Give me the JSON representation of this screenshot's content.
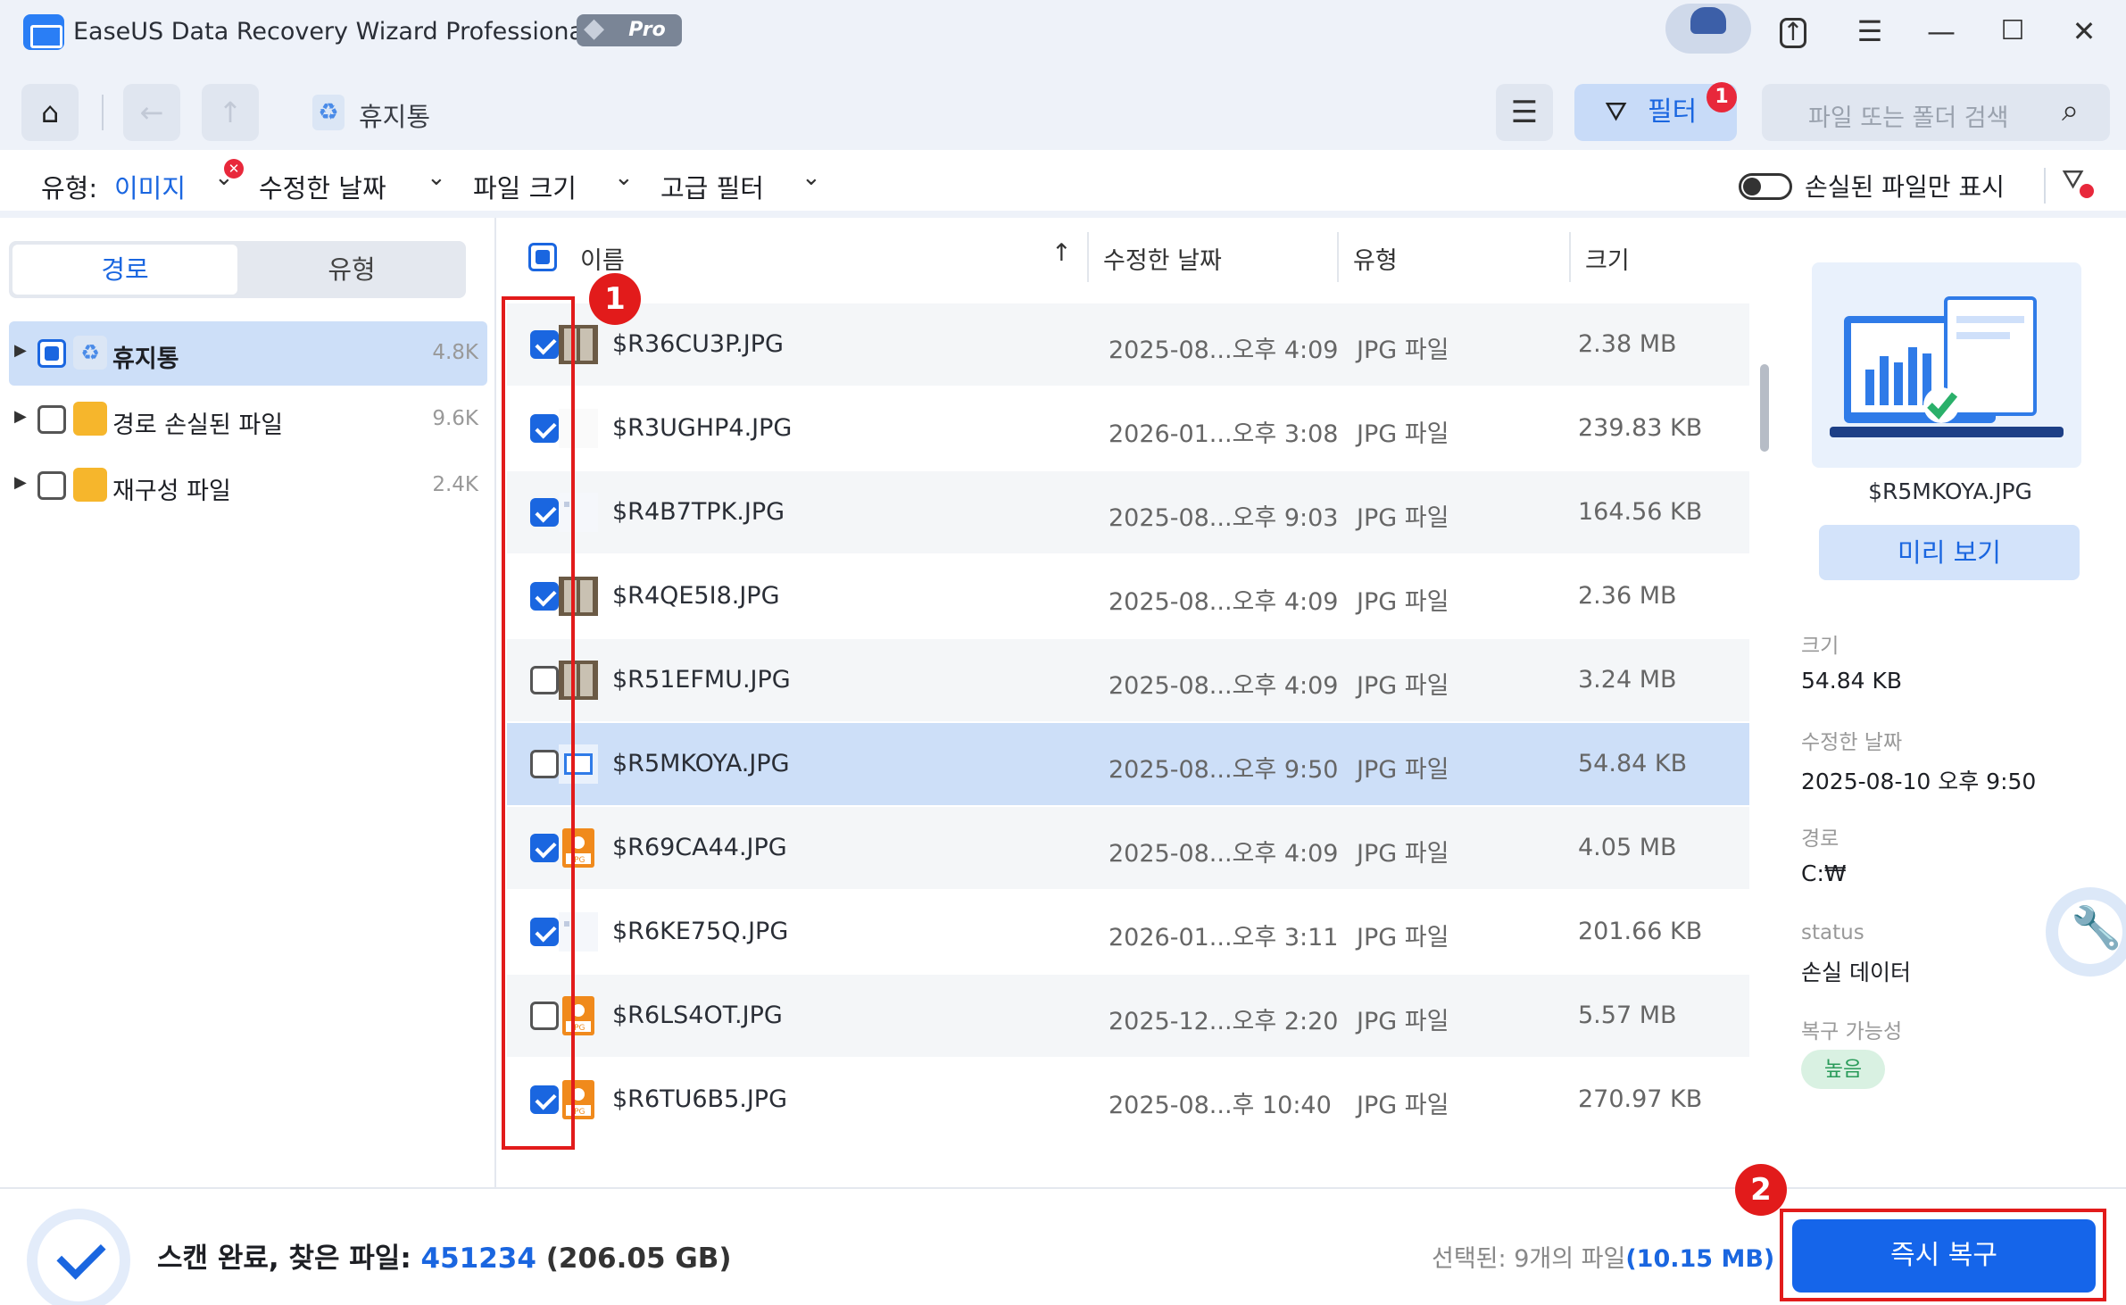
{
  "app": {
    "title": "EaseUS Data Recovery Wizard Professional",
    "badge": "Pro"
  },
  "nav": {
    "breadcrumb": "휴지통",
    "filter_label": "필터",
    "filter_count": "1",
    "search_placeholder": "파일 또는 폴더 검색"
  },
  "filters": {
    "type_label": "유형:",
    "type_value": "이미지",
    "modified_label": "수정한 날짜",
    "size_label": "파일 크기",
    "advanced_label": "고급 필터",
    "lost_only_label": "손실된 파일만 표시",
    "lost_only_on": false
  },
  "sidebar": {
    "tabs": [
      "경로",
      "유형"
    ],
    "active_tab": "경로",
    "items": [
      {
        "label": "휴지통",
        "count": "4.8K",
        "state": "partial",
        "selected": true
      },
      {
        "label": "경로 손실된 파일",
        "count": "9.6K",
        "state": "unchecked",
        "selected": false
      },
      {
        "label": "재구성 파일",
        "count": "2.4K",
        "state": "unchecked",
        "selected": false
      }
    ]
  },
  "table": {
    "columns": [
      "이름",
      "수정한 날짜",
      "유형",
      "크기"
    ],
    "sort_indicator": "↑",
    "rows": [
      {
        "name": "$R36CU3P.JPG",
        "date": "2025-08...오후 4:09",
        "type": "JPG 파일",
        "size": "2.38 MB",
        "checked": true,
        "selected": false,
        "thumb": "doors"
      },
      {
        "name": "$R3UGHP4.JPG",
        "date": "2026-01...오후 3:08",
        "type": "JPG 파일",
        "size": "239.83 KB",
        "checked": true,
        "selected": false,
        "thumb": "blank"
      },
      {
        "name": "$R4B7TPK.JPG",
        "date": "2025-08...오후 9:03",
        "type": "JPG 파일",
        "size": "164.56 KB",
        "checked": true,
        "selected": false,
        "thumb": "light"
      },
      {
        "name": "$R4QE5I8.JPG",
        "date": "2025-08...오후 4:09",
        "type": "JPG 파일",
        "size": "2.36 MB",
        "checked": true,
        "selected": false,
        "thumb": "doors"
      },
      {
        "name": "$R51EFMU.JPG",
        "date": "2025-08...오후 4:09",
        "type": "JPG 파일",
        "size": "3.24 MB",
        "checked": false,
        "selected": false,
        "thumb": "doors"
      },
      {
        "name": "$R5MKOYA.JPG",
        "date": "2025-08...오후 9:50",
        "type": "JPG 파일",
        "size": "54.84 KB",
        "checked": false,
        "selected": true,
        "thumb": "chart"
      },
      {
        "name": "$R69CA44.JPG",
        "date": "2025-08...오후 4:09",
        "type": "JPG 파일",
        "size": "4.05 MB",
        "checked": true,
        "selected": false,
        "thumb": "jpg"
      },
      {
        "name": "$R6KE75Q.JPG",
        "date": "2026-01...오후 3:11",
        "type": "JPG 파일",
        "size": "201.66 KB",
        "checked": true,
        "selected": false,
        "thumb": "light"
      },
      {
        "name": "$R6LS4OT.JPG",
        "date": "2025-12...오후 2:20",
        "type": "JPG 파일",
        "size": "5.57 MB",
        "checked": false,
        "selected": false,
        "thumb": "jpg"
      },
      {
        "name": "$R6TU6B5.JPG",
        "date": "2025-08...후 10:40",
        "type": "JPG 파일",
        "size": "270.97 KB",
        "checked": true,
        "selected": false,
        "thumb": "jpg"
      }
    ]
  },
  "details": {
    "filename": "$R5MKOYA.JPG",
    "preview_button": "미리 보기",
    "size_label": "크기",
    "size_value": "54.84 KB",
    "modified_label": "수정한 날짜",
    "modified_value": "2025-08-10 오후 9:50",
    "path_label": "경로",
    "path_value": "C:₩",
    "status_label": "status",
    "status_value": "손실 데이터",
    "recoverability_label": "복구 가능성",
    "recoverability_value": "높음"
  },
  "footer": {
    "scan_label": "스캔 완료, 찾은 파일:",
    "found_count": "451234",
    "found_size": "(206.05 GB)",
    "selected_prefix": "선택된: 9개의 파일",
    "selected_size": "(10.15 MB)",
    "recover_button": "즉시 복구"
  },
  "annotations": {
    "callout_1": "1",
    "callout_2": "2"
  },
  "colors": {
    "accent": "#1a66e0",
    "recover": "#1565ea",
    "highlight": "#e21b1b",
    "selected_row": "#cddff8"
  }
}
